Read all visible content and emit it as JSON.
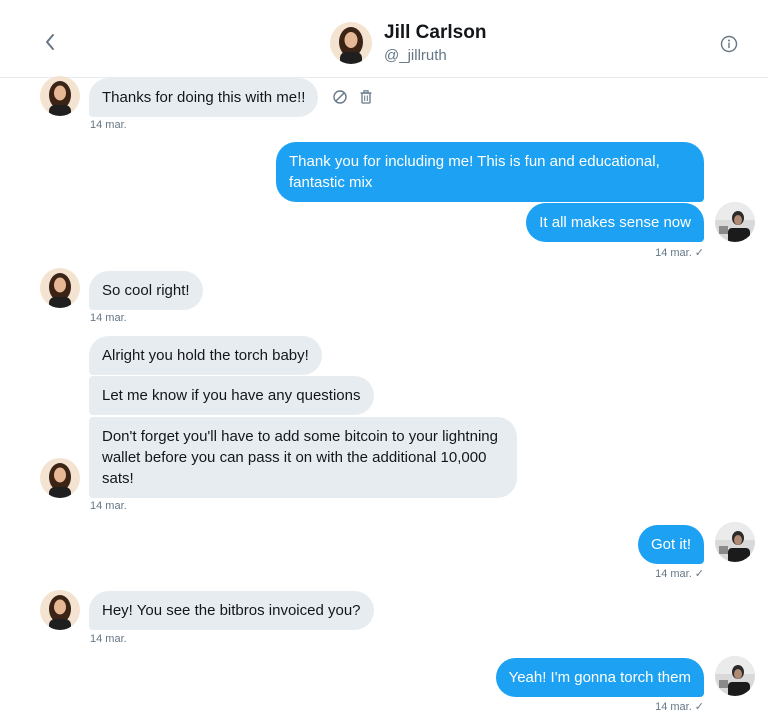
{
  "header": {
    "name": "Jill Carlson",
    "handle": "@_jillruth"
  },
  "messages": [
    {
      "side": "in",
      "text": "Thanks for doing this with me!!",
      "timestamp": "14 mar."
    },
    {
      "side": "out",
      "text": "Thank you for including me! This is fun and educational, fantastic mix"
    },
    {
      "side": "out",
      "text": "It all makes sense now",
      "timestamp": "14 mar.",
      "status": "✓"
    },
    {
      "side": "in",
      "text": "So cool right!",
      "timestamp": "14 mar."
    },
    {
      "side": "in",
      "text": "Alright you hold the torch baby!"
    },
    {
      "side": "in",
      "text": "Let me know if you have any questions"
    },
    {
      "side": "in",
      "text": "Don't forget you'll have to add some bitcoin to your lightning wallet before you can pass it on with the additional 10,000 sats!",
      "timestamp": "14 mar."
    },
    {
      "side": "out",
      "text": "Got it!",
      "timestamp": "14 mar.",
      "status": "✓"
    },
    {
      "side": "in",
      "text": "Hey! You see the bitbros invoiced you?",
      "timestamp": "14 mar."
    },
    {
      "side": "out",
      "text": "Yeah! I'm gonna torch them",
      "timestamp": "14 mar.",
      "status": "✓"
    }
  ],
  "colors": {
    "accent": "#1da1f2",
    "incoming_bubble": "#e6ecf0",
    "muted_text": "#657786"
  },
  "icons": {
    "back": "chevron-left-icon",
    "info": "info-icon",
    "mute": "block-icon",
    "delete": "trash-icon"
  }
}
